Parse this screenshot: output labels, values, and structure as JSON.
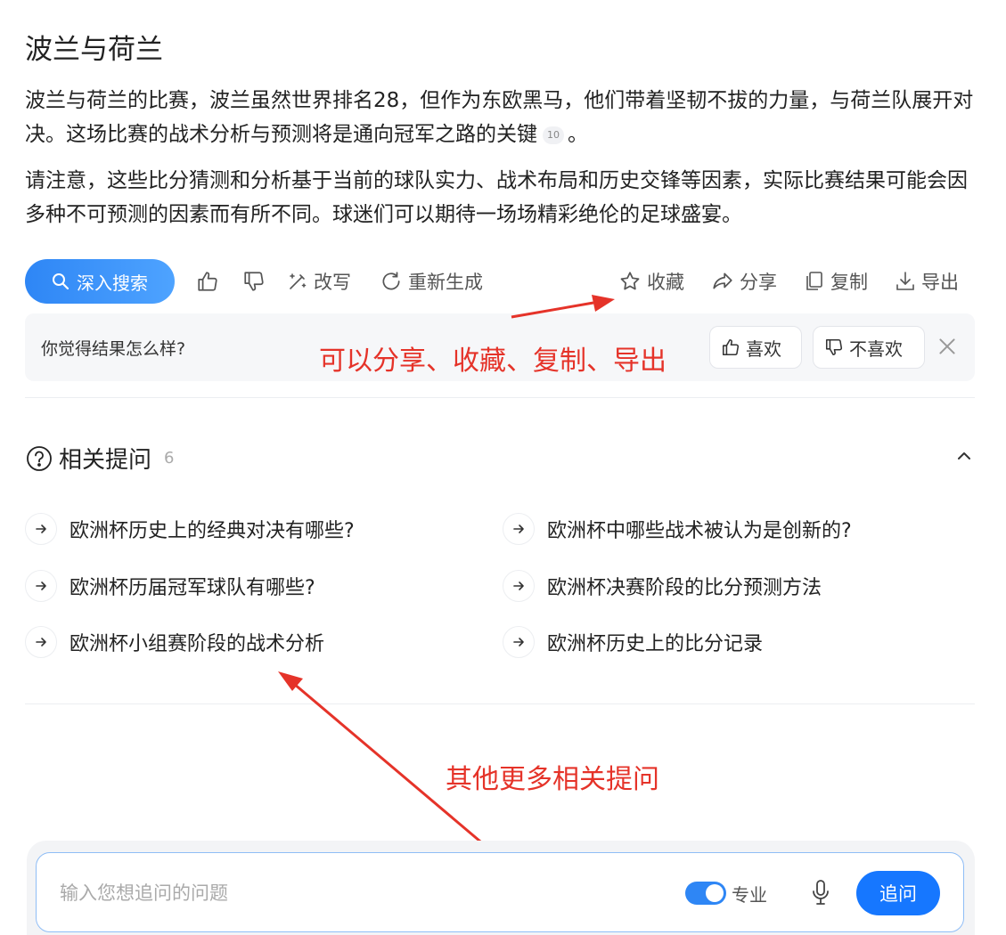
{
  "answer": {
    "title": "波兰与荷兰",
    "paragraph1": "波兰与荷兰的比赛，波兰虽然世界排名28，但作为东欧黑马，他们带着坚韧不拔的力量，与荷兰队展开对决。这场比赛的战术分析与预测将是通向冠军之路的关键",
    "citation": "10",
    "paragraph1_end": "。",
    "paragraph2": "请注意，这些比分猜测和分析基于当前的球队实力、战术布局和历史交锋等因素，实际比赛结果可能会因多种不可预测的因素而有所不同。球迷们可以期待一场场精彩绝伦的足球盛宴。"
  },
  "toolbar": {
    "deep_search": "深入搜索",
    "rewrite": "改写",
    "regenerate": "重新生成",
    "collect": "收藏",
    "share": "分享",
    "copy": "复制",
    "export": "导出"
  },
  "feedback": {
    "question": "你觉得结果怎么样?",
    "like": "喜欢",
    "dislike": "不喜欢"
  },
  "related": {
    "title": "相关提问",
    "count": "6",
    "items": [
      "欧洲杯历史上的经典对决有哪些?",
      "欧洲杯中哪些战术被认为是创新的?",
      "欧洲杯历届冠军球队有哪些?",
      "欧洲杯决赛阶段的比分预测方法",
      "欧洲杯小组赛阶段的战术分析",
      "欧洲杯历史上的比分记录"
    ]
  },
  "annotations": {
    "share_note": "可以分享、收藏、复制、导出",
    "related_note": "其他更多相关提问"
  },
  "composer": {
    "placeholder": "输入您想追问的问题",
    "pro_label": "专业",
    "pro_enabled": true,
    "send": "追问"
  },
  "colors": {
    "accent": "#1677ff",
    "annotation": "#e53329"
  }
}
